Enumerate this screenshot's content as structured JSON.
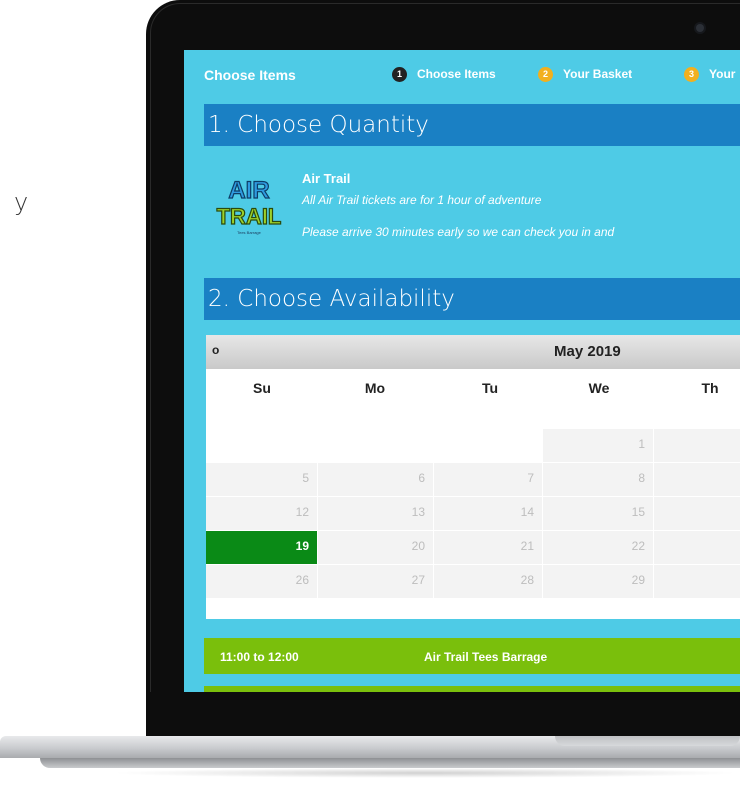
{
  "background_text": "y",
  "header": {
    "brand": "Choose Items",
    "steps": [
      {
        "num": "1",
        "label": "Choose Items"
      },
      {
        "num": "2",
        "label": "Your Basket"
      },
      {
        "num": "3",
        "label": "Your"
      }
    ]
  },
  "section1": {
    "title": "1. Choose Quantity"
  },
  "product": {
    "logo_text_1": "AIR",
    "logo_text_2": "TRAIL",
    "logo_text_3": "Tees Barrage",
    "title": "Air Trail",
    "description": "All Air Trail tickets are for 1 hour of adventure",
    "note": "Please arrive 30 minutes early so we can check you in and"
  },
  "section2": {
    "title": "2. Choose Availability"
  },
  "calendar": {
    "prev": "o",
    "month": "May 2019",
    "weekdays": [
      "Su",
      "Mo",
      "Tu",
      "We",
      "Th"
    ],
    "rows": [
      [
        "",
        "",
        "",
        "1",
        ""
      ],
      [
        "5",
        "6",
        "7",
        "8",
        ""
      ],
      [
        "12",
        "13",
        "14",
        "15",
        ""
      ],
      [
        "19",
        "20",
        "21",
        "22",
        ""
      ],
      [
        "26",
        "27",
        "28",
        "29",
        ""
      ]
    ],
    "selected": "19"
  },
  "slot": {
    "time": "11:00 to 12:00",
    "name": "Air Trail Tees Barrage"
  },
  "colors": {
    "screen_bg": "#4ecbe6",
    "section_bar": "#1a80c4",
    "slot_green": "#7abf0c",
    "selected_day": "#0a8a16",
    "step_amber": "#f2b01e"
  }
}
